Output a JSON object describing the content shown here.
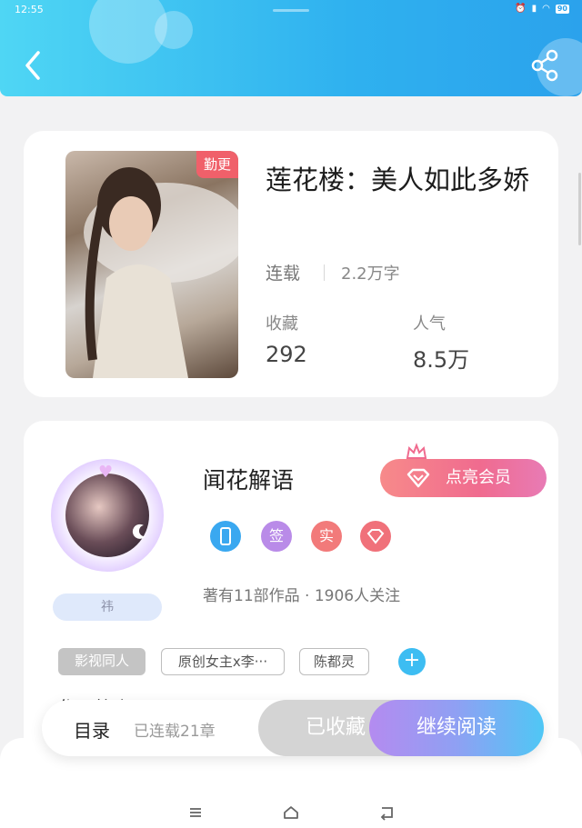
{
  "status_bar": {
    "time": "12:55",
    "battery": "90"
  },
  "colors": {
    "header_start": "#4fd6f4",
    "header_end": "#2ba2ec",
    "vip": "#f06b8f",
    "read_button_end": "#4fc7f5",
    "cover_tag": "#f0606a"
  },
  "header": {
    "back_icon": "chevron-left-icon",
    "share_icon": "share-icon"
  },
  "book": {
    "tag": "勤更",
    "title": "莲花楼：美人如此多娇",
    "status": "连载",
    "word_count": "2.2万字",
    "favorites_label": "收藏",
    "favorites_value": "292",
    "popularity_label": "人气",
    "popularity_value": "8.5万"
  },
  "author": {
    "name": "闻花解语",
    "badge": "祎",
    "vip_button": "点亮会员",
    "badges": [
      "签",
      "实"
    ],
    "meta": "著有11部作品 · 1906人关注",
    "tags": [
      "影视同人",
      "原创女主x李···",
      "陈都灵"
    ],
    "works_peek": "作品简介"
  },
  "action_bar": {
    "toc": "目录",
    "chapter_count": "已连载21章",
    "collected": "已收藏",
    "continue": "继续阅读"
  },
  "nav": {
    "menu_icon": "menu-icon",
    "home_icon": "home-icon",
    "back_icon": "back-icon"
  }
}
